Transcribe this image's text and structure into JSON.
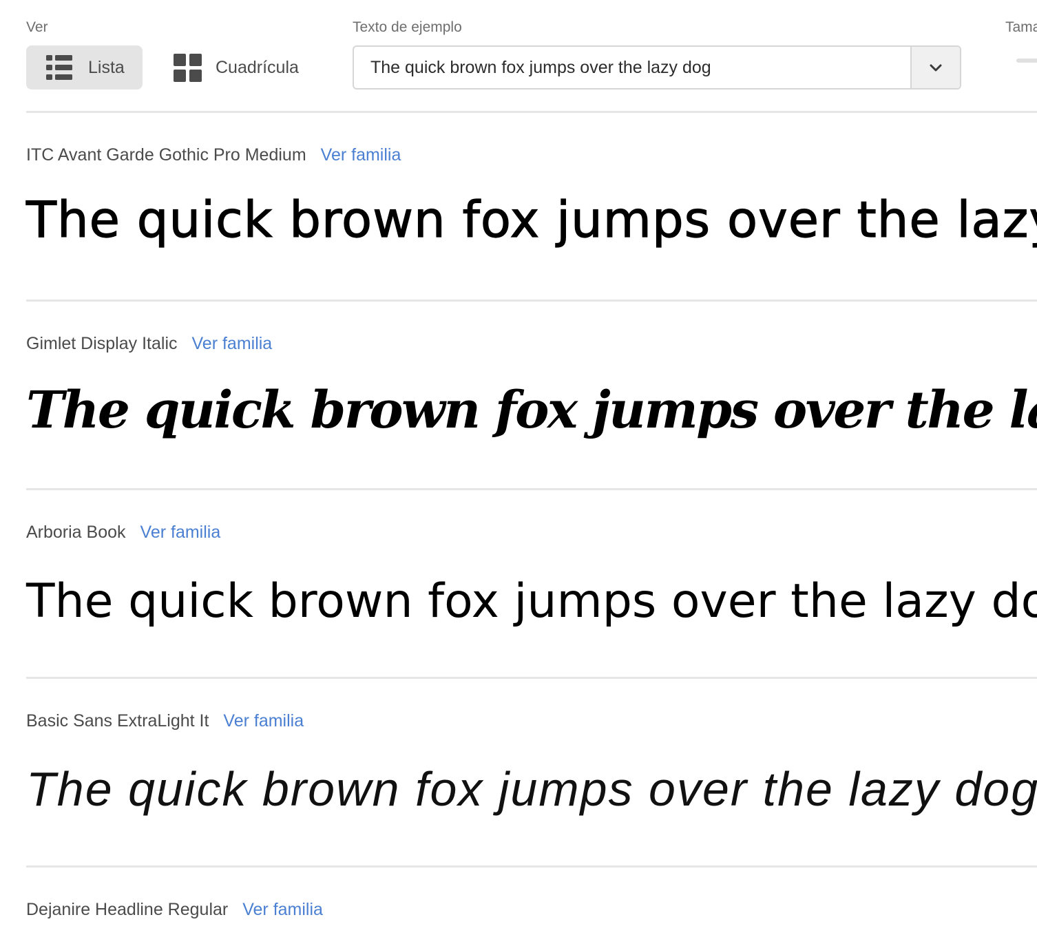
{
  "toolbar": {
    "view_label": "Ver",
    "view_options": [
      {
        "label": "Lista",
        "icon": "list-icon",
        "active": true
      },
      {
        "label": "Cuadrícula",
        "icon": "grid-icon",
        "active": false
      }
    ],
    "sample_text_label": "Texto de ejemplo",
    "sample_text_value": "The quick brown fox jumps over the lazy dog",
    "size_label_partial": "Tama"
  },
  "fonts": [
    {
      "name": "ITC Avant Garde Gothic Pro Medium",
      "link": "Ver familia",
      "sample": "The quick brown fox jumps over the lazy dog"
    },
    {
      "name": "Gimlet Display Italic",
      "link": "Ver familia",
      "sample": "The quick brown fox jumps over the lazy dog"
    },
    {
      "name": "Arboria Book",
      "link": "Ver familia",
      "sample": "The quick brown fox jumps over the lazy dog"
    },
    {
      "name": "Basic Sans ExtraLight It",
      "link": "Ver familia",
      "sample": "The quick brown fox jumps over the lazy dog"
    },
    {
      "name": "Dejanire Headline Regular",
      "link": "Ver familia"
    }
  ],
  "colors": {
    "link": "#4a7fd2",
    "active_button_bg": "#e4e4e4",
    "divider": "#e6e6e6"
  }
}
